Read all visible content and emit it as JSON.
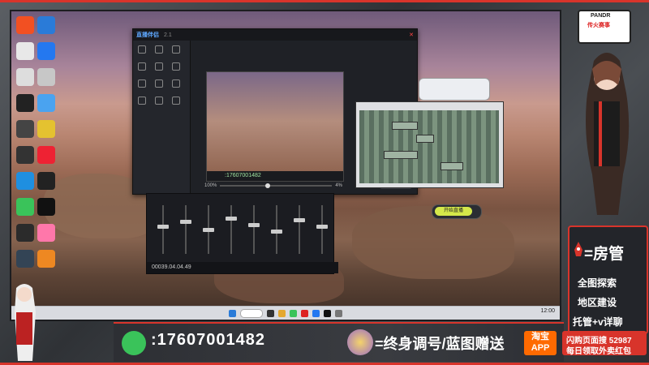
{
  "stream_overlay": {
    "phone_number": ":17607001482",
    "service_banner": "=终身调号/蓝图赠送",
    "badge_pandr": "PANDR",
    "badge_sub": "传火赛事",
    "room_admin": "=房管",
    "services": [
      "全图探索",
      "地区建设",
      "托管+v详聊"
    ],
    "taobao_label": "淘宝\nAPP",
    "ad_line_1": "闪购页面搜 52987",
    "ad_line_2": "每日领取外卖红包"
  },
  "live_app": {
    "title": "直播伴侣",
    "version": "2.1",
    "go_live_button": "开始直播",
    "volume_percent_1": "100%",
    "volume_percent_2": "4%",
    "preview_caption": ":17607001482",
    "start_label": "开始直播"
  },
  "mixer": {
    "timecode": "00039.04.04.49"
  },
  "taskbar": {
    "clock": "12:00"
  },
  "colors": {
    "accent_red": "#d8342b",
    "wechat_green": "#3ac35a",
    "taobao_orange": "#ff6a00",
    "pill_green": "#d4e84a"
  },
  "icons": [
    "wechat-icon",
    "rank-badge-icon",
    "rocket-icon",
    "taobao-icon"
  ]
}
